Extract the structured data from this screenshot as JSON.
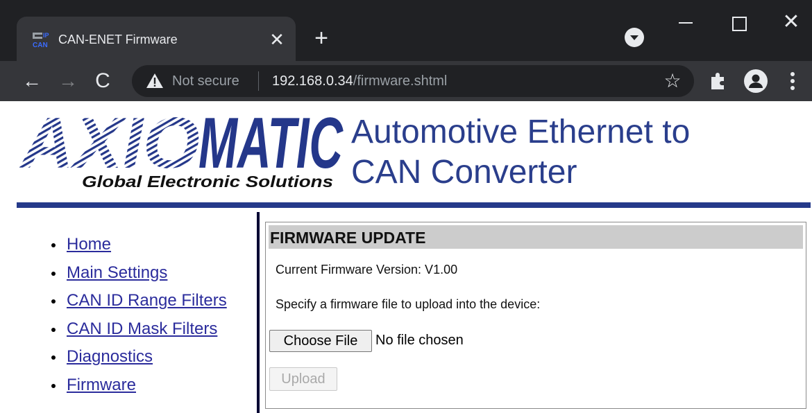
{
  "browser": {
    "tab": {
      "title": "CAN-ENET Firmware",
      "favicon": "ip-can-favicon",
      "close_glyph": "✕"
    },
    "new_tab_glyph": "+",
    "window_controls": {
      "minimize": "window-minimize-icon",
      "maximize": "window-maximize-icon",
      "close_glyph": "✕"
    },
    "nav": {
      "back_glyph": "←",
      "forward_glyph": "→",
      "reload_glyph": "C"
    },
    "address_bar": {
      "security_label": "Not secure",
      "url_host": "192.168.0.34",
      "url_path": "/firmware.shtml"
    },
    "star_glyph": "☆",
    "icons": [
      "tab-search-icon",
      "extensions-icon",
      "profile-icon",
      "menu-icon"
    ]
  },
  "header": {
    "logo_text": "AXIOMATIC",
    "logo_tagline": "Global Electronic Solutions",
    "title_line1": "Automotive Ethernet to",
    "title_line2": "CAN Converter",
    "accent_color": "#253a8a"
  },
  "nav": {
    "items": [
      {
        "label": "Home"
      },
      {
        "label": "Main Settings"
      },
      {
        "label": "CAN ID Range Filters"
      },
      {
        "label": "CAN ID Mask Filters"
      },
      {
        "label": "Diagnostics"
      },
      {
        "label": "Firmware"
      }
    ],
    "link_color": "#2b2c9c"
  },
  "firmware": {
    "title": "FIRMWARE UPDATE",
    "version_text": "Current Firmware Version: V1.00",
    "instructions": "Specify a firmware file to upload into the device:",
    "choose_file_label": "Choose File",
    "file_status": "No file chosen",
    "upload_label": "Upload"
  }
}
